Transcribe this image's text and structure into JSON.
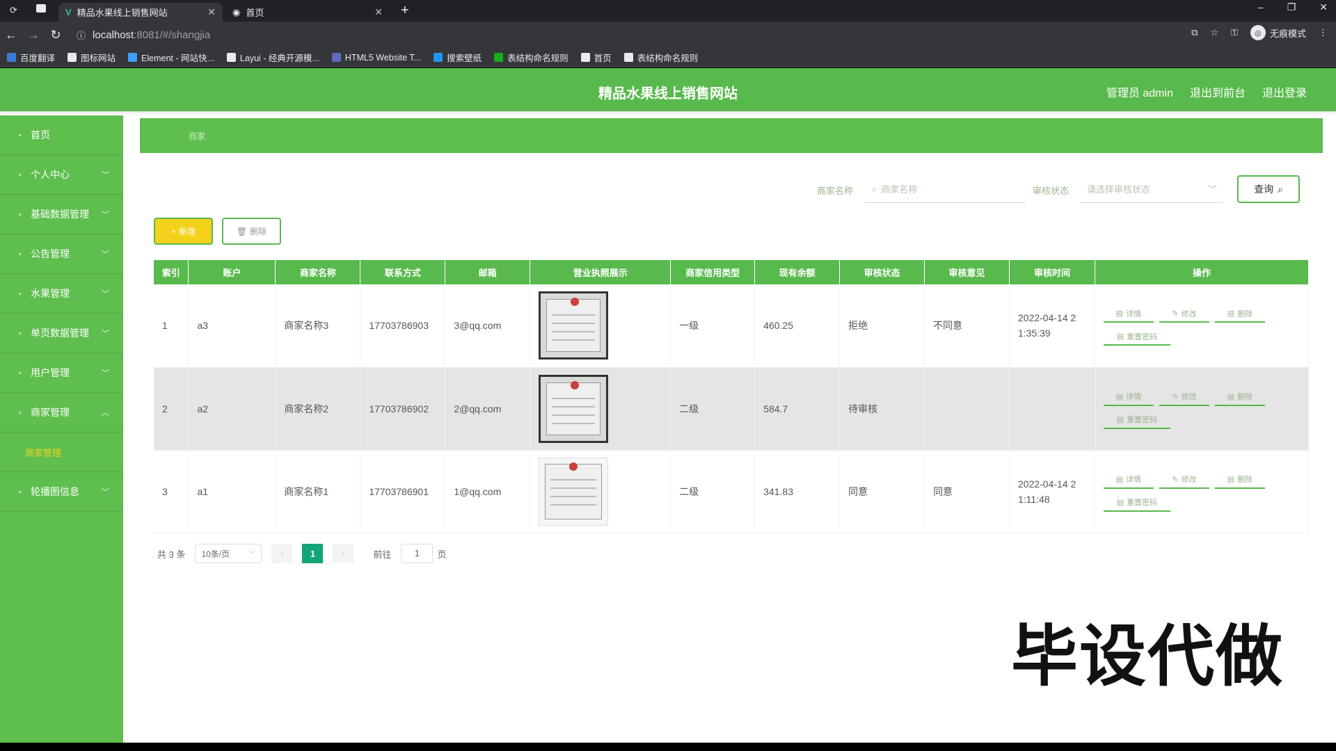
{
  "browser": {
    "tabs": [
      {
        "title": "精品水果线上销售网站",
        "active": true
      },
      {
        "title": "首页",
        "active": false
      }
    ],
    "url_host": "localhost",
    "url_rest": ":8081/#/shangjia",
    "profile_label": "无痕模式",
    "bookmarks": [
      {
        "label": "百度翻译",
        "color": "#3a7bd5"
      },
      {
        "label": "图标网站",
        "color": "#e8eaed"
      },
      {
        "label": "Element - 网站快...",
        "color": "#409eff"
      },
      {
        "label": "Layui - 经典开源模...",
        "color": "#e8eaed"
      },
      {
        "label": "HTML5 Website T...",
        "color": "#5c6bc0"
      },
      {
        "label": "搜索壁纸",
        "color": "#2196f3"
      },
      {
        "label": "表结构命名规则",
        "color": "#1aad19"
      },
      {
        "label": "首页",
        "color": "#e8eaed"
      },
      {
        "label": "表结构命名规则",
        "color": "#e8eaed"
      }
    ]
  },
  "header": {
    "site_title": "精品水果线上销售网站",
    "admin_label": "管理员 admin",
    "back_frontend": "退出到前台",
    "logout": "退出登录"
  },
  "sidebar": {
    "items": [
      {
        "label": "首页",
        "icon": "home-icon",
        "has_chevron": false
      },
      {
        "label": "个人中心",
        "icon": "user-icon",
        "has_chevron": true,
        "chevron": "﹀"
      },
      {
        "label": "基础数据管理",
        "icon": "grid-icon",
        "has_chevron": true,
        "chevron": "﹀"
      },
      {
        "label": "公告管理",
        "icon": "notice-icon",
        "has_chevron": true,
        "chevron": "﹀"
      },
      {
        "label": "水果管理",
        "icon": "fruit-icon",
        "has_chevron": true,
        "chevron": "﹀"
      },
      {
        "label": "单页数据管理",
        "icon": "page-icon",
        "has_chevron": true,
        "chevron": "﹀"
      },
      {
        "label": "用户管理",
        "icon": "users-icon",
        "has_chevron": true,
        "chevron": "﹀"
      },
      {
        "label": "商家管理",
        "icon": "shop-icon",
        "has_chevron": true,
        "chevron": "︿"
      }
    ],
    "active_sub": "商家管理",
    "last_item": {
      "label": "轮播图信息",
      "icon": "image-icon",
      "chevron": "﹀"
    }
  },
  "breadcrumb": "商家",
  "filters": {
    "name_label": "商家名称",
    "name_placeholder": "商家名称",
    "status_label": "审核状态",
    "status_placeholder": "请选择审核状态",
    "query_label": "查询"
  },
  "actions": {
    "add_label": "新增",
    "delete_label": "删除"
  },
  "table": {
    "headers": [
      "索引",
      "账户",
      "商家名称",
      "联系方式",
      "邮箱",
      "营业执照展示",
      "商家信用类型",
      "现有余额",
      "审核状态",
      "审核意见",
      "审核时间",
      "操作"
    ],
    "rows": [
      {
        "index": "1",
        "account": "a3",
        "name": "商家名称3",
        "phone": "17703786903",
        "email": "3@qq.com",
        "credit": "一级",
        "balance": "460.25",
        "status": "拒绝",
        "opinion": "不同意",
        "time": "2022-04-14 2 1:35:39"
      },
      {
        "index": "2",
        "account": "a2",
        "name": "商家名称2",
        "phone": "17703786902",
        "email": "2@qq.com",
        "credit": "二级",
        "balance": "584.7",
        "status": "待审核",
        "opinion": "",
        "time": ""
      },
      {
        "index": "3",
        "account": "a1",
        "name": "商家名称1",
        "phone": "17703786901",
        "email": "1@qq.com",
        "credit": "二级",
        "balance": "341.83",
        "status": "同意",
        "opinion": "同意",
        "time": "2022-04-14 2 1:11:48"
      }
    ],
    "op_labels": {
      "detail": "详情",
      "edit": "修改",
      "delete": "删除",
      "reset": "重置密码"
    }
  },
  "pagination": {
    "total": "共 3 条",
    "page_size": "10条/页",
    "current": "1",
    "goto_prefix": "前往",
    "goto_value": "1",
    "goto_suffix": "页"
  },
  "watermark": "毕设代做",
  "colors": {
    "primary": "#58b94c",
    "accent_yellow": "#f4d21c",
    "pager_active": "#13a578"
  }
}
